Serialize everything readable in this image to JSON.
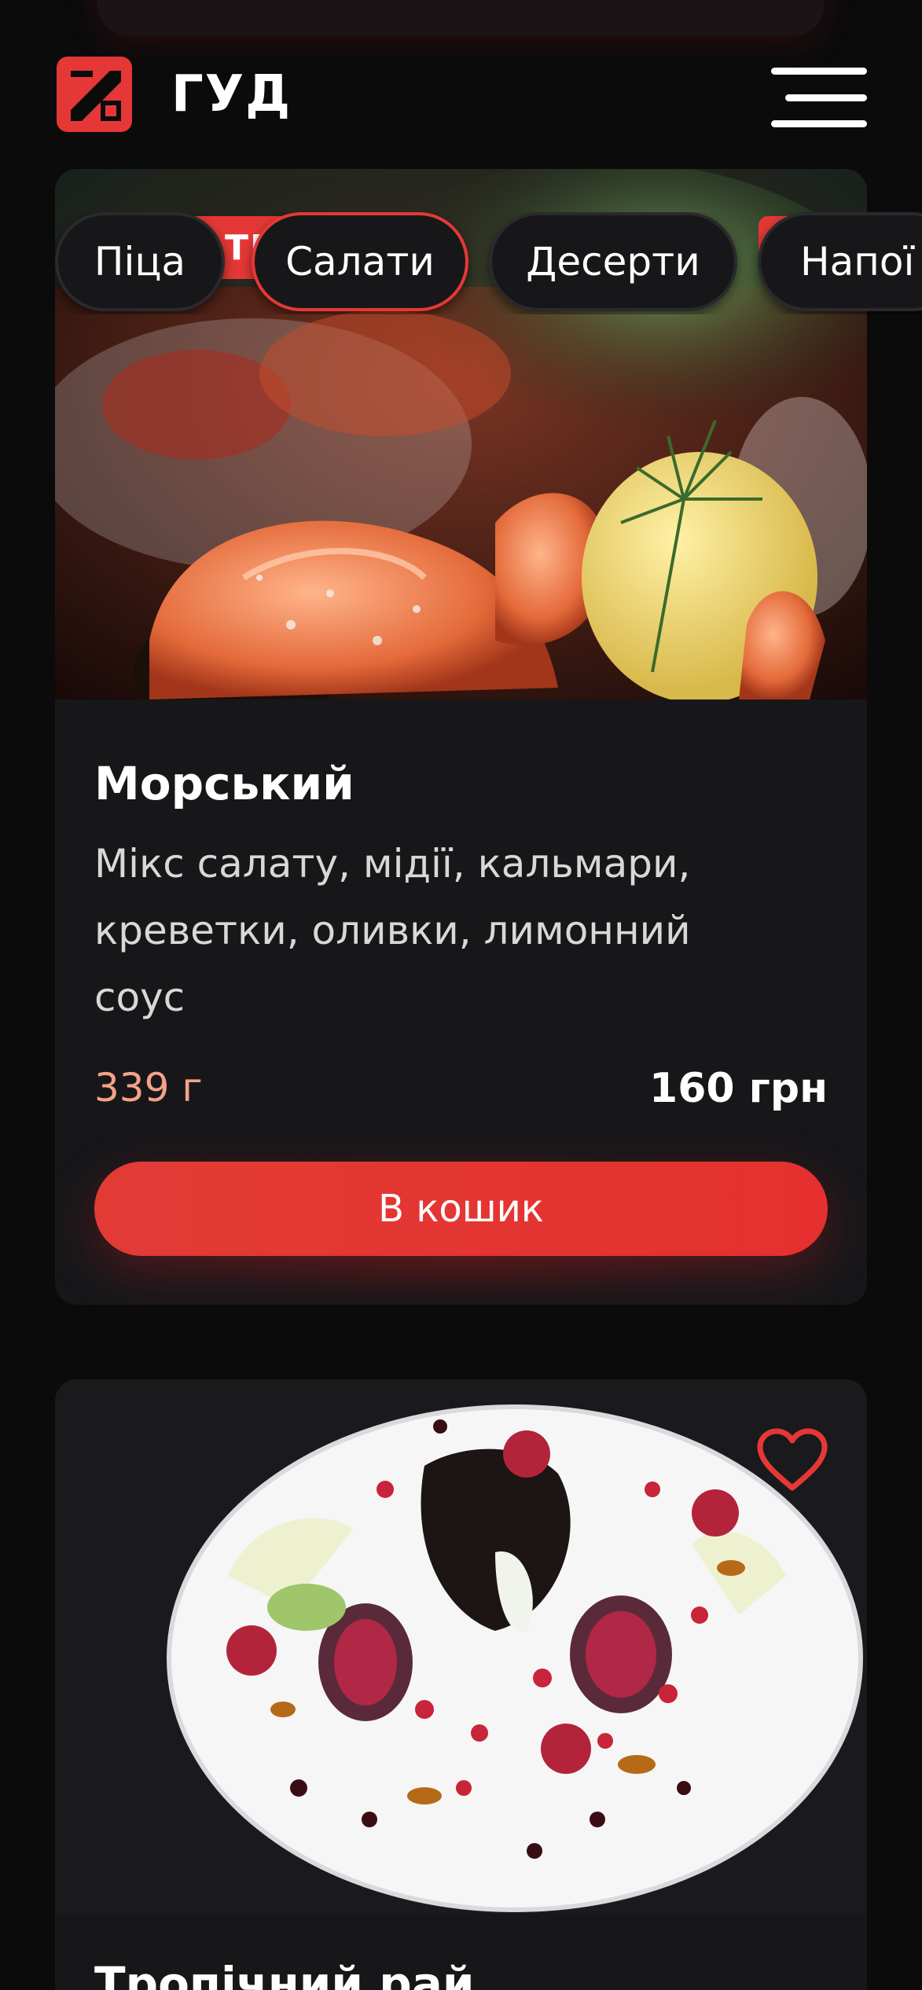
{
  "brand": {
    "name": "ГУД"
  },
  "categories": [
    {
      "label": "Піца",
      "active": false
    },
    {
      "label": "Салати",
      "active": true
    },
    {
      "label": "Десерти",
      "active": false
    },
    {
      "label": "Напої",
      "active": false
    }
  ],
  "badge": {
    "text": "ТР"
  },
  "products": [
    {
      "name": "Морський",
      "description": "Мікс салату, мідії, кальмари, креветки, оливки, лимонний соус",
      "desc_lines": [
        "Мікс салату, мідії, кальмари,",
        "креветки, оливки, лимонний",
        "соус"
      ],
      "weight": "339 г",
      "price": "160 грн",
      "cart_label": "В кошик"
    },
    {
      "name": "Тропічний рай"
    }
  ],
  "icons": {
    "logo": "brand-logo-icon",
    "menu": "hamburger-menu-icon",
    "favorite": "heart-outline-icon"
  },
  "colors": {
    "accent": "#e53836",
    "background": "#0b0b0c",
    "card": "#17171a",
    "weight_text": "#f4a287"
  }
}
